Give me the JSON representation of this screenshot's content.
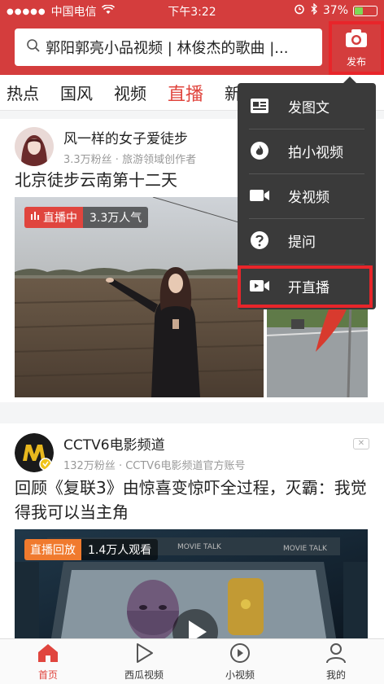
{
  "status_bar": {
    "carrier": "中国电信",
    "time": "下午3:22",
    "battery": "37%",
    "battery_level": 0.37
  },
  "header": {
    "search_text": "郭阳郭亮小品视频 | 林俊杰的歌曲 |...",
    "publish_label": "发布"
  },
  "tabs": [
    {
      "label": "热点"
    },
    {
      "label": "国风"
    },
    {
      "label": "视频"
    },
    {
      "label": "直播",
      "active": true
    },
    {
      "label": "新"
    }
  ],
  "popup_menu": [
    {
      "label": "发图文",
      "icon": "image-text-icon"
    },
    {
      "label": "拍小视频",
      "icon": "flame-icon"
    },
    {
      "label": "发视频",
      "icon": "video-camera-icon"
    },
    {
      "label": "提问",
      "icon": "question-icon"
    },
    {
      "label": "开直播",
      "icon": "live-camera-icon"
    }
  ],
  "feed": [
    {
      "author": "风一样的女子爱徒步",
      "meta": "3.3万粉丝 · 旅游领域创作者",
      "title": "北京徒步云南第十二天",
      "badge_live": "直播中",
      "badge_count": "3.3万人气"
    },
    {
      "author": "CCTV6电影频道",
      "meta": "132万粉丝 · CCTV6电影频道官方账号",
      "title": "回顾《复联3》由惊喜变惊吓全过程，灭霸：我觉得我可以当主角",
      "badge_live": "直播回放",
      "badge_count": "1.4万人观看",
      "poster_text": "MOVIE TALK"
    }
  ],
  "bottom_nav": [
    {
      "label": "首页",
      "active": true
    },
    {
      "label": "西瓜视频"
    },
    {
      "label": "小视频"
    },
    {
      "label": "我的"
    }
  ],
  "colors": {
    "brand_red": "#d43d3d",
    "accent_red": "#e0453e",
    "highlight_box": "#e8252a"
  }
}
